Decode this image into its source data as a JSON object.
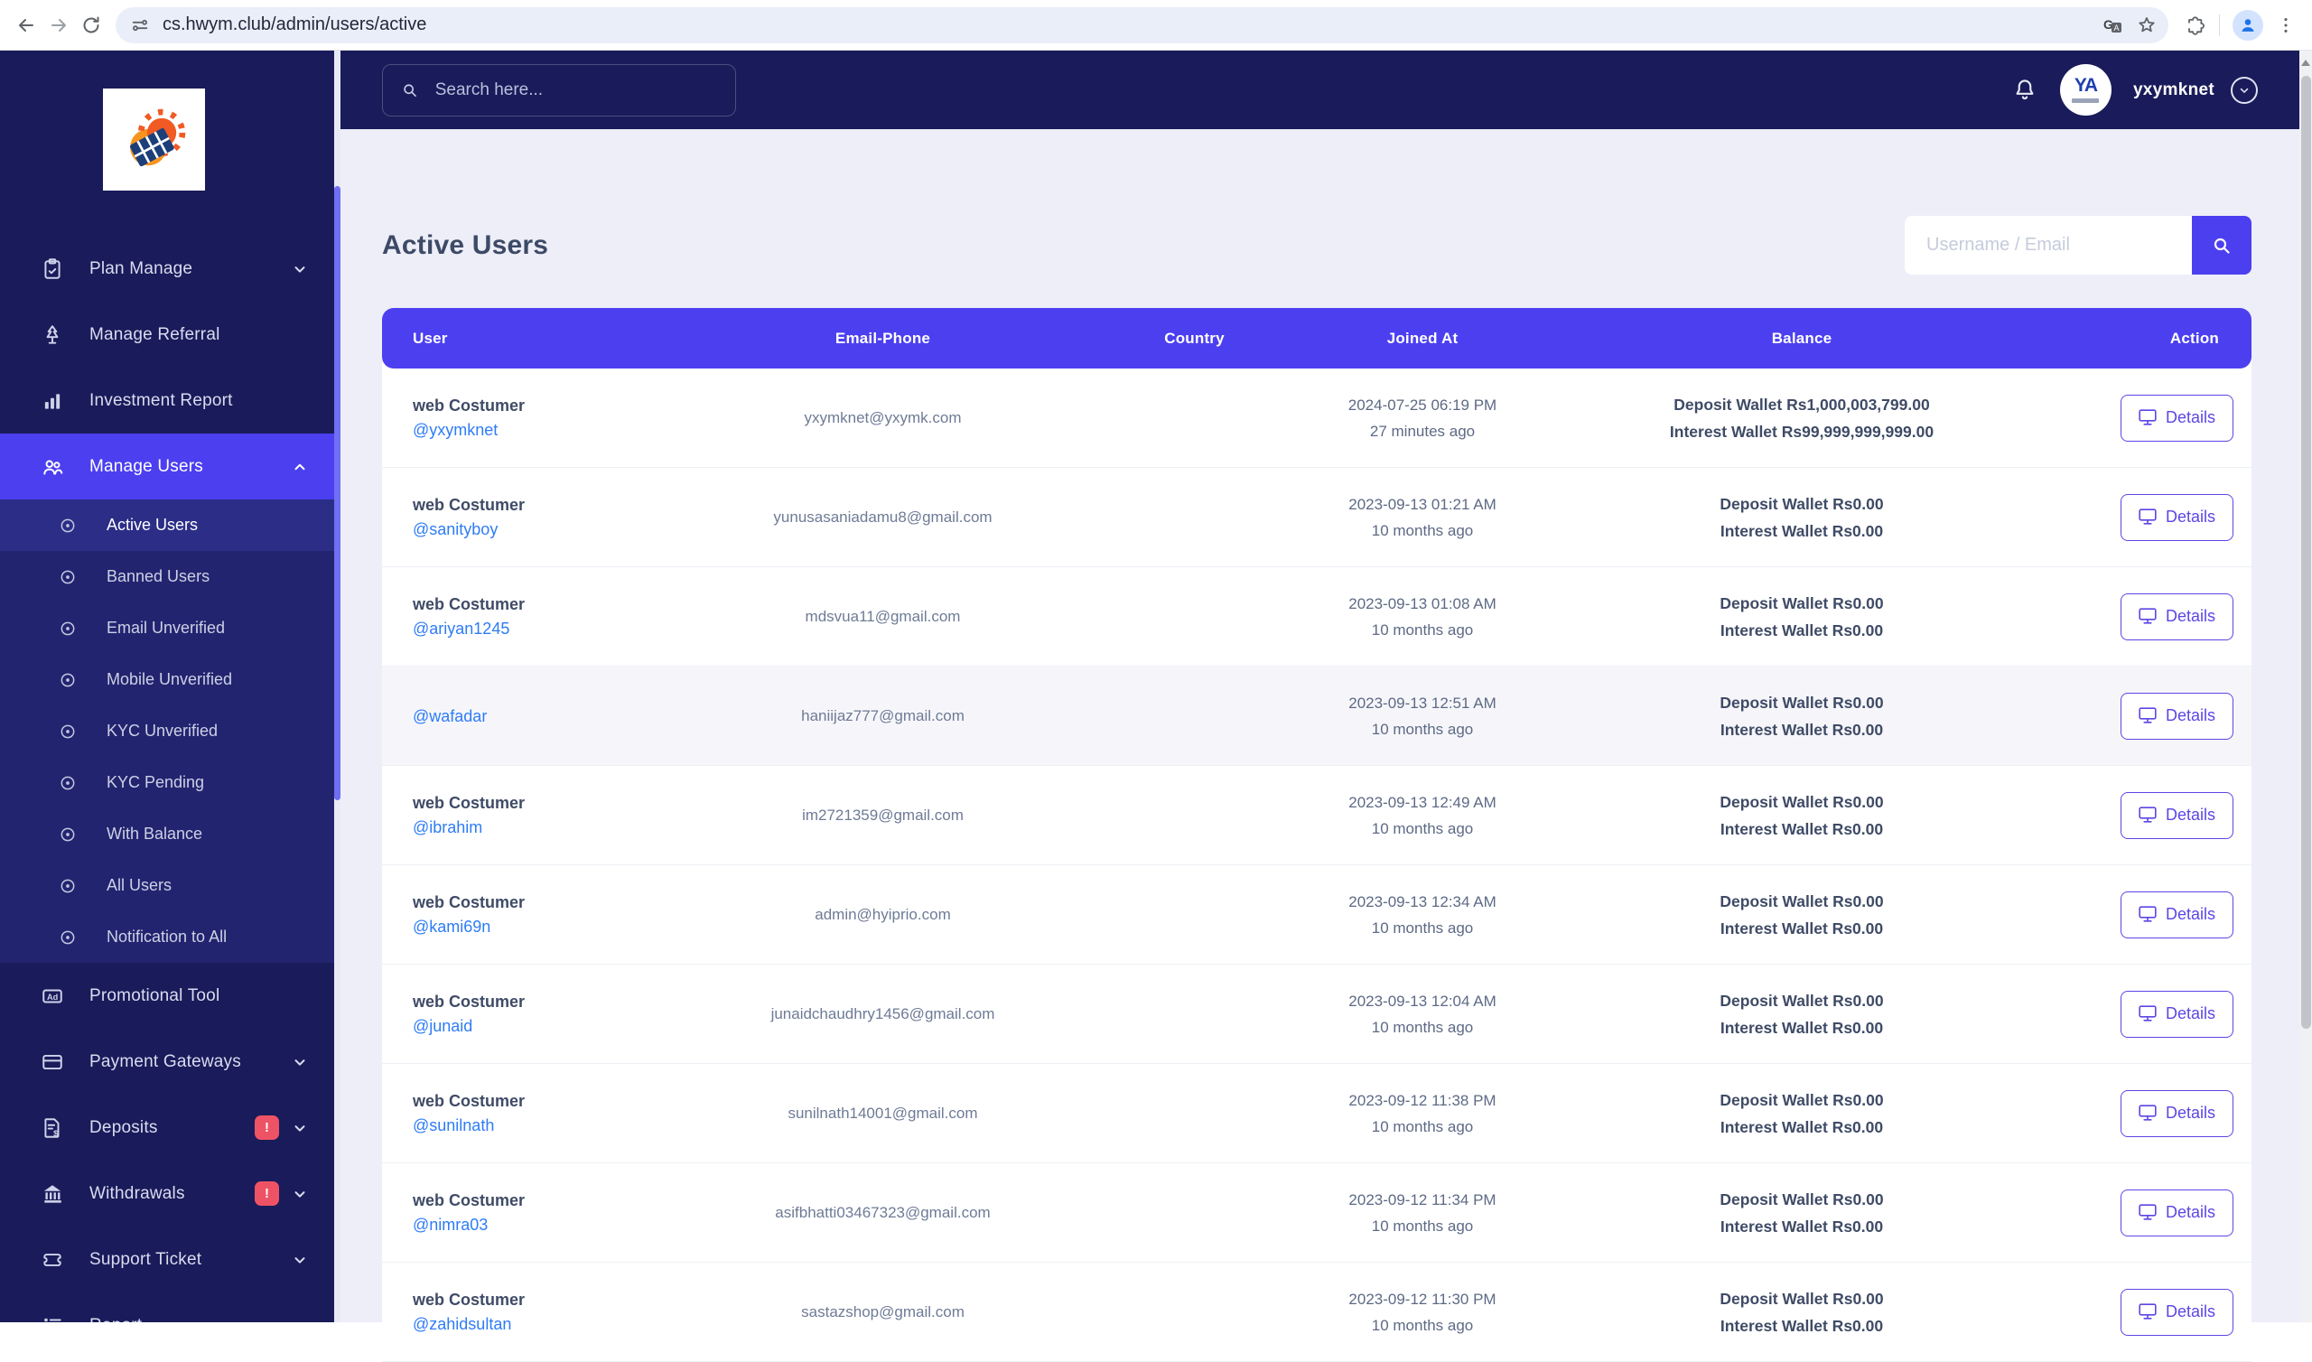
{
  "colors": {
    "sidebar_navy": "#1a1b5a",
    "accent_indigo": "#4c3ff0",
    "button_violet": "#5b46e5",
    "link_blue": "#2e7cf6",
    "badge_red": "#ee5365",
    "content_bg": "#edeef8"
  },
  "chrome": {
    "url": "cs.hwym.club/admin/users/active"
  },
  "topbar": {
    "search_placeholder": "Search here...",
    "username": "yxymknet",
    "avatar_monogram": "YA"
  },
  "sidebar": {
    "top": [
      {
        "label": "Plan Manage",
        "icon": "clipboard-icon",
        "chevron": "down"
      },
      {
        "label": "Manage Referral",
        "icon": "tree-icon"
      },
      {
        "label": "Investment Report",
        "icon": "bar-chart-icon"
      },
      {
        "label": "Manage Users",
        "icon": "users-icon",
        "chevron": "up",
        "active": true
      }
    ],
    "submenu": [
      "Active Users",
      "Banned Users",
      "Email Unverified",
      "Mobile Unverified",
      "KYC Unverified",
      "KYC Pending",
      "With Balance",
      "All Users",
      "Notification to All"
    ],
    "bottom": [
      {
        "label": "Promotional Tool",
        "icon": "ad-icon"
      },
      {
        "label": "Payment Gateways",
        "icon": "credit-card-icon",
        "chevron": "down"
      },
      {
        "label": "Deposits",
        "icon": "invoice-icon",
        "badge": "!",
        "chevron": "down"
      },
      {
        "label": "Withdrawals",
        "icon": "bank-icon",
        "badge": "!",
        "chevron": "down"
      },
      {
        "label": "Support Ticket",
        "icon": "ticket-icon",
        "chevron": "down"
      },
      {
        "label": "Report",
        "icon": "report-icon"
      }
    ]
  },
  "page": {
    "title": "Active Users",
    "filter_placeholder": "Username / Email"
  },
  "table": {
    "columns": [
      "User",
      "Email-Phone",
      "Country",
      "Joined At",
      "Balance",
      "Action"
    ],
    "details_label": "Details",
    "rows": [
      {
        "name": "web Costumer",
        "handle": "@yxymknet",
        "email": "yxymknet@yxymk.com",
        "country": "",
        "joined": "2024-07-25 06:19 PM",
        "ago": "27 minutes ago",
        "deposit": "Deposit Wallet Rs1,000,003,799.00",
        "interest": "Interest Wallet Rs99,999,999,999.00"
      },
      {
        "name": "web Costumer",
        "handle": "@sanityboy",
        "email": "yunusasaniadamu8@gmail.com",
        "country": "",
        "joined": "2023-09-13 01:21 AM",
        "ago": "10 months ago",
        "deposit": "Deposit Wallet Rs0.00",
        "interest": "Interest Wallet Rs0.00"
      },
      {
        "name": "web Costumer",
        "handle": "@ariyan1245",
        "email": "mdsvua11@gmail.com",
        "country": "",
        "joined": "2023-09-13 01:08 AM",
        "ago": "10 months ago",
        "deposit": "Deposit Wallet Rs0.00",
        "interest": "Interest Wallet Rs0.00"
      },
      {
        "name": "",
        "handle": "@wafadar",
        "email": "haniijaz777@gmail.com",
        "country": "",
        "joined": "2023-09-13 12:51 AM",
        "ago": "10 months ago",
        "deposit": "Deposit Wallet Rs0.00",
        "interest": "Interest Wallet Rs0.00"
      },
      {
        "name": "web Costumer",
        "handle": "@ibrahim",
        "email": "im2721359@gmail.com",
        "country": "",
        "joined": "2023-09-13 12:49 AM",
        "ago": "10 months ago",
        "deposit": "Deposit Wallet Rs0.00",
        "interest": "Interest Wallet Rs0.00"
      },
      {
        "name": "web Costumer",
        "handle": "@kami69n",
        "email": "admin@hyiprio.com",
        "country": "",
        "joined": "2023-09-13 12:34 AM",
        "ago": "10 months ago",
        "deposit": "Deposit Wallet Rs0.00",
        "interest": "Interest Wallet Rs0.00"
      },
      {
        "name": "web Costumer",
        "handle": "@junaid",
        "email": "junaidchaudhry1456@gmail.com",
        "country": "",
        "joined": "2023-09-13 12:04 AM",
        "ago": "10 months ago",
        "deposit": "Deposit Wallet Rs0.00",
        "interest": "Interest Wallet Rs0.00"
      },
      {
        "name": "web Costumer",
        "handle": "@sunilnath",
        "email": "sunilnath14001@gmail.com",
        "country": "",
        "joined": "2023-09-12 11:38 PM",
        "ago": "10 months ago",
        "deposit": "Deposit Wallet Rs0.00",
        "interest": "Interest Wallet Rs0.00"
      },
      {
        "name": "web Costumer",
        "handle": "@nimra03",
        "email": "asifbhatti03467323@gmail.com",
        "country": "",
        "joined": "2023-09-12 11:34 PM",
        "ago": "10 months ago",
        "deposit": "Deposit Wallet Rs0.00",
        "interest": "Interest Wallet Rs0.00"
      },
      {
        "name": "web Costumer",
        "handle": "@zahidsultan",
        "email": "sastazshop@gmail.com",
        "country": "",
        "joined": "2023-09-12 11:30 PM",
        "ago": "10 months ago",
        "deposit": "Deposit Wallet Rs0.00",
        "interest": "Interest Wallet Rs0.00"
      }
    ]
  }
}
